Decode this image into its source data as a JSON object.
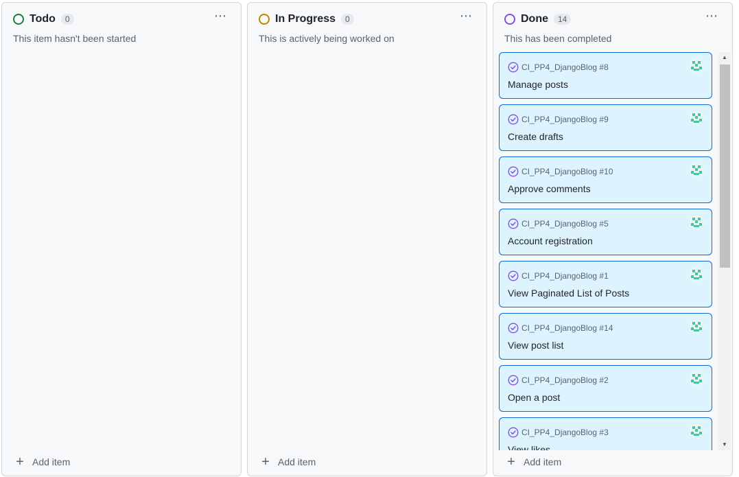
{
  "board": {
    "columns": [
      {
        "title": "Todo",
        "count": "0",
        "description": "This item hasn't been started",
        "status_color": "#1a7f37",
        "more_label": "⋯",
        "add_label": "Add item",
        "cards": []
      },
      {
        "title": "In Progress",
        "count": "0",
        "description": "This is actively being worked on",
        "status_color": "#bf8700",
        "more_label": "⋯",
        "add_label": "Add item",
        "cards": []
      },
      {
        "title": "Done",
        "count": "14",
        "description": "This has been completed",
        "status_color": "#8250df",
        "more_label": "⋯",
        "add_label": "Add item",
        "cards": [
          {
            "repo_ref": "CI_PP4_DjangoBlog #8",
            "title": "Manage posts",
            "icon": "closed-issue-check-icon"
          },
          {
            "repo_ref": "CI_PP4_DjangoBlog #9",
            "title": "Create drafts",
            "icon": "closed-issue-check-icon"
          },
          {
            "repo_ref": "CI_PP4_DjangoBlog #10",
            "title": "Approve comments",
            "icon": "closed-issue-check-icon"
          },
          {
            "repo_ref": "CI_PP4_DjangoBlog #5",
            "title": "Account registration",
            "icon": "closed-issue-check-icon"
          },
          {
            "repo_ref": "CI_PP4_DjangoBlog #1",
            "title": "View Paginated List of Posts",
            "icon": "closed-issue-check-icon"
          },
          {
            "repo_ref": "CI_PP4_DjangoBlog #14",
            "title": "View post list",
            "icon": "closed-issue-check-icon"
          },
          {
            "repo_ref": "CI_PP4_DjangoBlog #2",
            "title": "Open a post",
            "icon": "closed-issue-check-icon"
          },
          {
            "repo_ref": "CI_PP4_DjangoBlog #3",
            "title": "View likes",
            "icon": "closed-issue-check-icon"
          }
        ]
      }
    ],
    "colors": {
      "card_bg": "#ddf4ff",
      "card_border": "#0969da",
      "done_icon": "#8250df",
      "avatar": "#4fc3a1"
    }
  }
}
